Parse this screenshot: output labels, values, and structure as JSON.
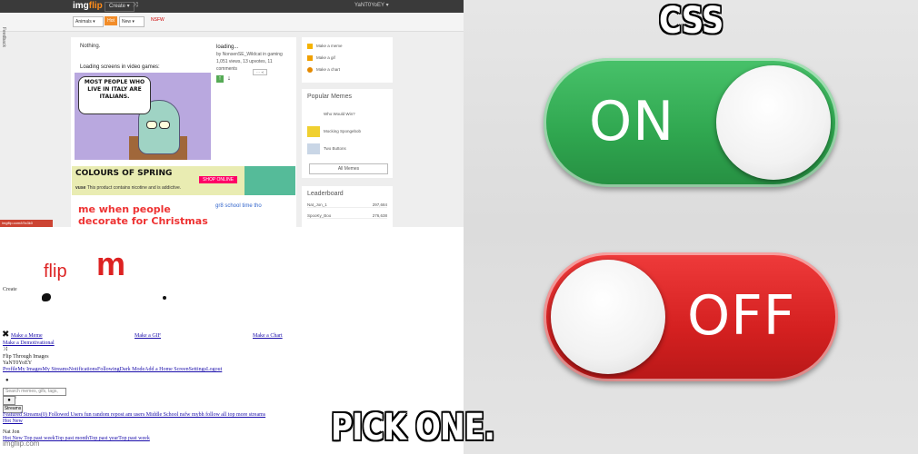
{
  "imgflip_page": {
    "logo": {
      "prefix": "img",
      "suffix": "flip"
    },
    "create_label": "Create ▾",
    "user_label": "YaNT0YoEY ▾",
    "filter_select": "Animals ▾",
    "hot_label": "Hot",
    "new_label": "New ▾",
    "flag_label": "NSFW",
    "feedback_label": "Feedback",
    "post": {
      "title": "Nothing.",
      "caption": "Loading screens in video games:",
      "meme_text": "MOST PEOPLE WHO LIVE IN ITALY ARE ITALIANS.",
      "meta_title": "loading...",
      "meta_lines": [
        "by NonsenSE_Wildcat in gaming",
        "1,051 views, 13 upvotes, 11 comments"
      ]
    },
    "ad": {
      "headline": "COLOURS OF SPRING",
      "brand": "vuse",
      "disclaimer": "This product contains nicotine and is addictive.",
      "button": "SHOP ONLINE"
    },
    "post2": {
      "title": "me when people decorate for Christmas in October:",
      "meta": "gr8 school time tho"
    },
    "sidebar_links": [
      {
        "label": "Make a meme",
        "color": "#f5b300"
      },
      {
        "label": "Make a gif",
        "color": "#f0a000"
      },
      {
        "label": "Make a chart",
        "color": "#e58a00"
      }
    ],
    "popular": {
      "heading": "Popular Memes",
      "items": [
        "Who Would Win?",
        "Mocking Spongebob",
        "Two Buttons"
      ],
      "all_label": "All Memes"
    },
    "leaderboard": {
      "heading": "Leaderboard",
      "rows": [
        {
          "name": "Nat_Jon_1",
          "score": "297,684"
        },
        {
          "name": "SpooKy_Boo",
          "score": "276,638"
        },
        {
          "name": "",
          "score": ""
        }
      ]
    },
    "url_tag": "imgflip.com/i/9c3k0"
  },
  "broken_page": {
    "logo_flip": "flip",
    "logo_m": "m",
    "create": "Create",
    "nav_links": [
      "Make a Meme",
      "Make a GIF",
      "Make a Chart"
    ],
    "lines": [
      "Make a Demotivational",
      "Flip Through Images",
      "YaNT0YoEY",
      "ProfileMy ImagesMy StreamsNotificationsFollowingDark ModeAdd a Home ScreenSettingsLogout"
    ],
    "search_placeholder": "Search memes, gifs, tags, users",
    "search_button": "●",
    "streams_button": "Streams",
    "more_lines": [
      "Featured Streams(0)   Followed Users   fun   random   repost   am   users   Middle School   nsfw   mybh   follow   all   top   more   streams",
      "Hot New",
      "Nat Jon",
      "Hot   New   Top   past   weekTop   past   monthTop   past   yearTop   past   week"
    ],
    "watermark": "imgflip.com"
  },
  "meme_captions": {
    "top": "CSS",
    "bottom": "PICK ONE."
  },
  "toggles": {
    "on": {
      "label": "ON",
      "color": "#2fa64f"
    },
    "off": {
      "label": "OFF",
      "color": "#d42020"
    }
  }
}
